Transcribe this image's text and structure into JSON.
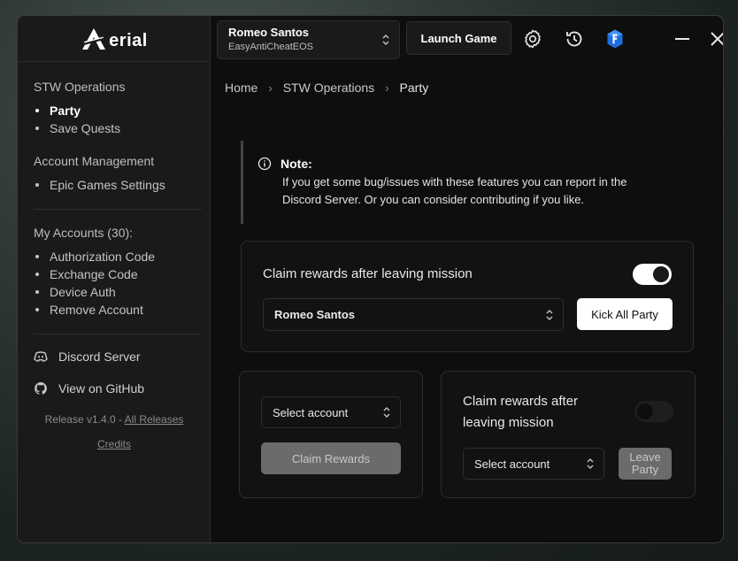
{
  "app": {
    "name": "erial"
  },
  "sidebar": {
    "stw": {
      "heading": "STW Operations",
      "items": [
        {
          "label": "Party"
        },
        {
          "label": "Save Quests"
        }
      ]
    },
    "account_mgmt": {
      "heading": "Account Management",
      "items": [
        {
          "label": "Epic Games Settings"
        }
      ]
    },
    "my_accounts": {
      "heading": "My Accounts (30):",
      "items": [
        {
          "label": "Authorization Code"
        },
        {
          "label": "Exchange Code"
        },
        {
          "label": "Device Auth"
        },
        {
          "label": "Remove Account"
        }
      ]
    },
    "links": {
      "discord": "Discord Server",
      "github": "View on GitHub"
    },
    "release": {
      "prefix": "Release v1.4.0 - ",
      "all_releases": "All Releases",
      "credits": "Credits"
    }
  },
  "topbar": {
    "account": {
      "name": "Romeo Santos",
      "sub": "EasyAntiCheatEOS"
    },
    "launch_label": "Launch Game"
  },
  "breadcrumb": {
    "home": "Home",
    "section": "STW Operations",
    "current": "Party"
  },
  "note": {
    "title": "Note:",
    "text": "If you get some bug/issues with these features you can report in the Discord Server. Or you can consider contributing if you like."
  },
  "main_card": {
    "claim_label": "Claim rewards after leaving mission",
    "toggle_on": true,
    "account_select": "Romeo Santos",
    "kick_label": "Kick All Party"
  },
  "left_card": {
    "select_placeholder": "Select account",
    "claim_button": "Claim Rewards"
  },
  "right_card": {
    "claim_label": "Claim rewards after leaving mission",
    "toggle_on": false,
    "select_placeholder": "Select account",
    "leave_button": "Leave Party"
  }
}
